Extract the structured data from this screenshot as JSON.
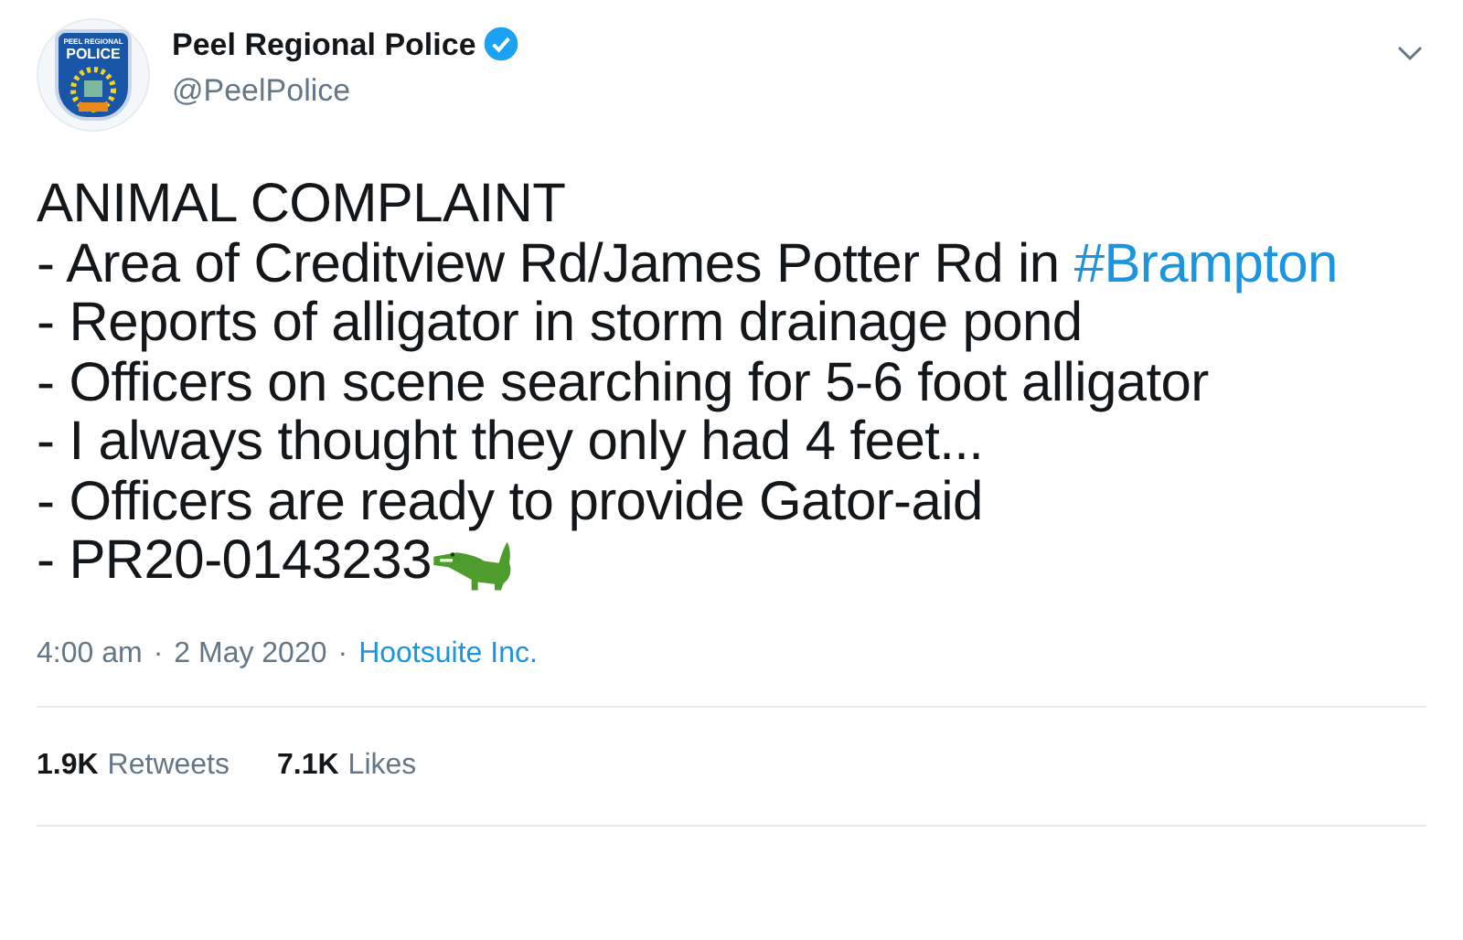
{
  "author": {
    "logo_top": "PEEL REGIONAL",
    "logo_main": "POLICE",
    "name": "Peel Regional Police",
    "verified": true,
    "handle": "@PeelPolice"
  },
  "body": [
    {
      "kind": "plain",
      "text": "ANIMAL COMPLAINT"
    },
    {
      "kind": "hashtag",
      "text": "- Area of Creditview Rd/James Potter Rd in ",
      "hashtag": "#Brampton"
    },
    {
      "kind": "plain",
      "text": "- Reports of alligator in storm drainage pond"
    },
    {
      "kind": "plain",
      "text": "- Officers on scene searching for 5-6 foot alligator"
    },
    {
      "kind": "plain",
      "text": "- I always thought they only had 4 feet..."
    },
    {
      "kind": "plain",
      "text": "- Officers are ready to provide Gator-aid"
    },
    {
      "kind": "emoji",
      "text": "- PR20-0143233"
    }
  ],
  "meta": {
    "time": "4:00 am",
    "separator": "·",
    "date": "2 May 2020",
    "separator_2": "·",
    "source": "Hootsuite Inc."
  },
  "stats": [
    {
      "count": "1.9K",
      "label": "Retweets"
    },
    {
      "count": "7.1K",
      "label": "Likes"
    }
  ]
}
